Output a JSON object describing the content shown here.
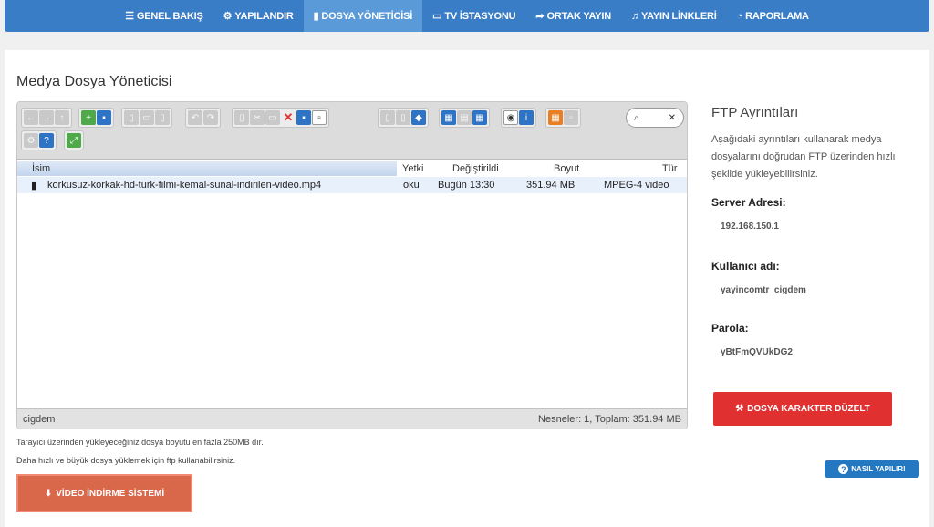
{
  "nav": [
    {
      "icon": "☰",
      "icon_name": "bars-icon",
      "label": "GENEL BAKIŞ",
      "active": false
    },
    {
      "icon": "⚙",
      "icon_name": "gears-icon",
      "label": "YAPILANDIR",
      "active": false
    },
    {
      "icon": "▮",
      "icon_name": "file-icon",
      "label": "DOSYA YÖNETİCİSİ",
      "active": true
    },
    {
      "icon": "▭",
      "icon_name": "tv-icon",
      "label": "TV İSTASYONU",
      "active": false
    },
    {
      "icon": "➦",
      "icon_name": "share-icon",
      "label": "ORTAK YAYIN",
      "active": false
    },
    {
      "icon": "♫",
      "icon_name": "music-icon",
      "label": "YAYIN LİNKLERİ",
      "active": false
    },
    {
      "icon": "◔",
      "icon_name": "pie-chart-icon",
      "label": "RAPORLAMA",
      "active": false
    }
  ],
  "page_title": "Medya Dosya Yöneticisi",
  "file_manager": {
    "columns": {
      "name": "İsim",
      "perm": "Yetki",
      "modified": "Değiştirildi",
      "size": "Boyut",
      "type": "Tür"
    },
    "files": [
      {
        "name": "korkusuz-korkak-hd-turk-filmi-kemal-sunal-indirilen-video.mp4",
        "perm": "oku",
        "modified": "Bugün 13:30",
        "size": "351.94 MB",
        "type": "MPEG-4 video"
      }
    ],
    "status_left": "cigdem",
    "status_right": "Nesneler: 1, Toplam: 351.94 MB"
  },
  "hints": [
    "Tarayıcı üzerinden yükleyeceğiniz dosya boyutu en fazla 250MB dır.",
    "Daha hızlı ve büyük dosya yüklemek için ftp kullanabilirsiniz."
  ],
  "video_button": "VİDEO İNDİRME SİSTEMİ",
  "ftp": {
    "title": "FTP Ayrıntıları",
    "description": "Aşağıdaki ayrıntıları kullanarak medya dosyalarını doğrudan FTP üzerinden hızlı şekilde yükleyebilirsiniz.",
    "server_label": "Server Adresi:",
    "server_value": "192.168.150.1",
    "user_label": "Kullanıcı adı:",
    "user_value": "yayincomtr_cigdem",
    "pass_label": "Parola:",
    "pass_value": "yBtFmQVUkDG2"
  },
  "fix_button": "DOSYA KARAKTER DÜZELT",
  "how_button": "NASIL YAPILIR!",
  "colors": {
    "nav_bg": "#3a7dc7",
    "nav_active": "#5b9ad8",
    "fix_btn": "#e03030",
    "video_btn": "#d9674a",
    "how_btn": "#2478c2"
  }
}
